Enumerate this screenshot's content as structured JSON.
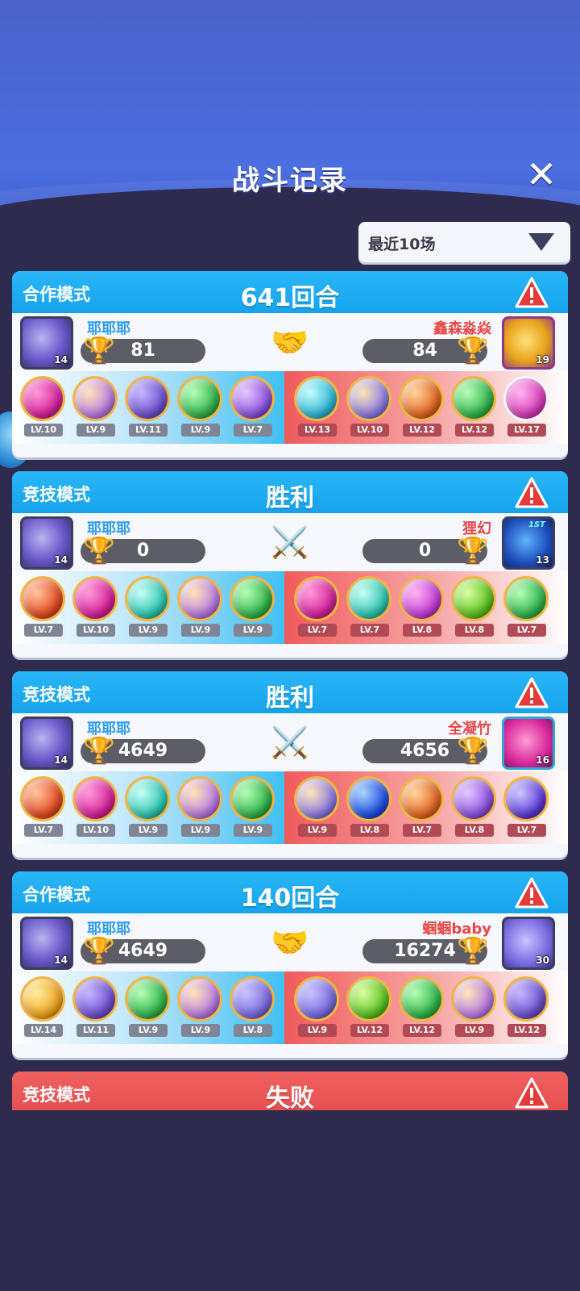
{
  "header": {
    "title": "战斗记录",
    "close_label": "✕"
  },
  "filter": {
    "selected": "最近10场"
  },
  "colors": {
    "coop_header": "#17a3ec",
    "lose_header": "#e54e4e",
    "player_name": "#2c9df2",
    "opponent_name": "#ec4646"
  },
  "records": [
    {
      "mode": "合作模式",
      "result": "641回合",
      "center_icon": "handshake-icon",
      "player": {
        "name": "耶耶耶",
        "score": "81",
        "level": "14"
      },
      "opponent": {
        "name": "鑫森淼焱",
        "score": "84",
        "level": "19"
      },
      "player_team": [
        {
          "lv": "LV.10"
        },
        {
          "lv": "LV.9"
        },
        {
          "lv": "LV.11"
        },
        {
          "lv": "LV.9"
        },
        {
          "lv": "LV.7"
        }
      ],
      "opponent_team": [
        {
          "lv": "LV.13"
        },
        {
          "lv": "LV.10"
        },
        {
          "lv": "LV.12"
        },
        {
          "lv": "LV.12"
        },
        {
          "lv": "LV.17"
        }
      ]
    },
    {
      "mode": "竞技模式",
      "result": "胜利",
      "center_icon": "crossed-swords-icon",
      "player": {
        "name": "耶耶耶",
        "score": "0",
        "level": "14"
      },
      "opponent": {
        "name": "狸幻",
        "score": "0",
        "level": "13",
        "badge": "1ST"
      },
      "player_team": [
        {
          "lv": "LV.7"
        },
        {
          "lv": "LV.10"
        },
        {
          "lv": "LV.9"
        },
        {
          "lv": "LV.9"
        },
        {
          "lv": "LV.9"
        }
      ],
      "opponent_team": [
        {
          "lv": "LV.7"
        },
        {
          "lv": "LV.7"
        },
        {
          "lv": "LV.8"
        },
        {
          "lv": "LV.8"
        },
        {
          "lv": "LV.7"
        }
      ]
    },
    {
      "mode": "竞技模式",
      "result": "胜利",
      "center_icon": "crossed-swords-icon",
      "player": {
        "name": "耶耶耶",
        "score": "4649",
        "level": "14"
      },
      "opponent": {
        "name": "全凝竹",
        "score": "4656",
        "level": "16"
      },
      "player_team": [
        {
          "lv": "LV.7"
        },
        {
          "lv": "LV.10"
        },
        {
          "lv": "LV.9"
        },
        {
          "lv": "LV.9"
        },
        {
          "lv": "LV.9"
        }
      ],
      "opponent_team": [
        {
          "lv": "LV.9"
        },
        {
          "lv": "LV.8"
        },
        {
          "lv": "LV.7"
        },
        {
          "lv": "LV.8"
        },
        {
          "lv": "LV.7"
        }
      ]
    },
    {
      "mode": "合作模式",
      "result": "140回合",
      "center_icon": "handshake-icon",
      "player": {
        "name": "耶耶耶",
        "score": "4649",
        "level": "14"
      },
      "opponent": {
        "name": "蝈蝈baby",
        "score": "16274",
        "level": "30"
      },
      "player_team": [
        {
          "lv": "LV.14"
        },
        {
          "lv": "LV.11"
        },
        {
          "lv": "LV.9"
        },
        {
          "lv": "LV.9"
        },
        {
          "lv": "LV.8"
        }
      ],
      "opponent_team": [
        {
          "lv": "LV.9"
        },
        {
          "lv": "LV.12"
        },
        {
          "lv": "LV.12"
        },
        {
          "lv": "LV.9"
        },
        {
          "lv": "LV.12"
        }
      ]
    },
    {
      "mode": "竞技模式",
      "result": "失败"
    }
  ]
}
